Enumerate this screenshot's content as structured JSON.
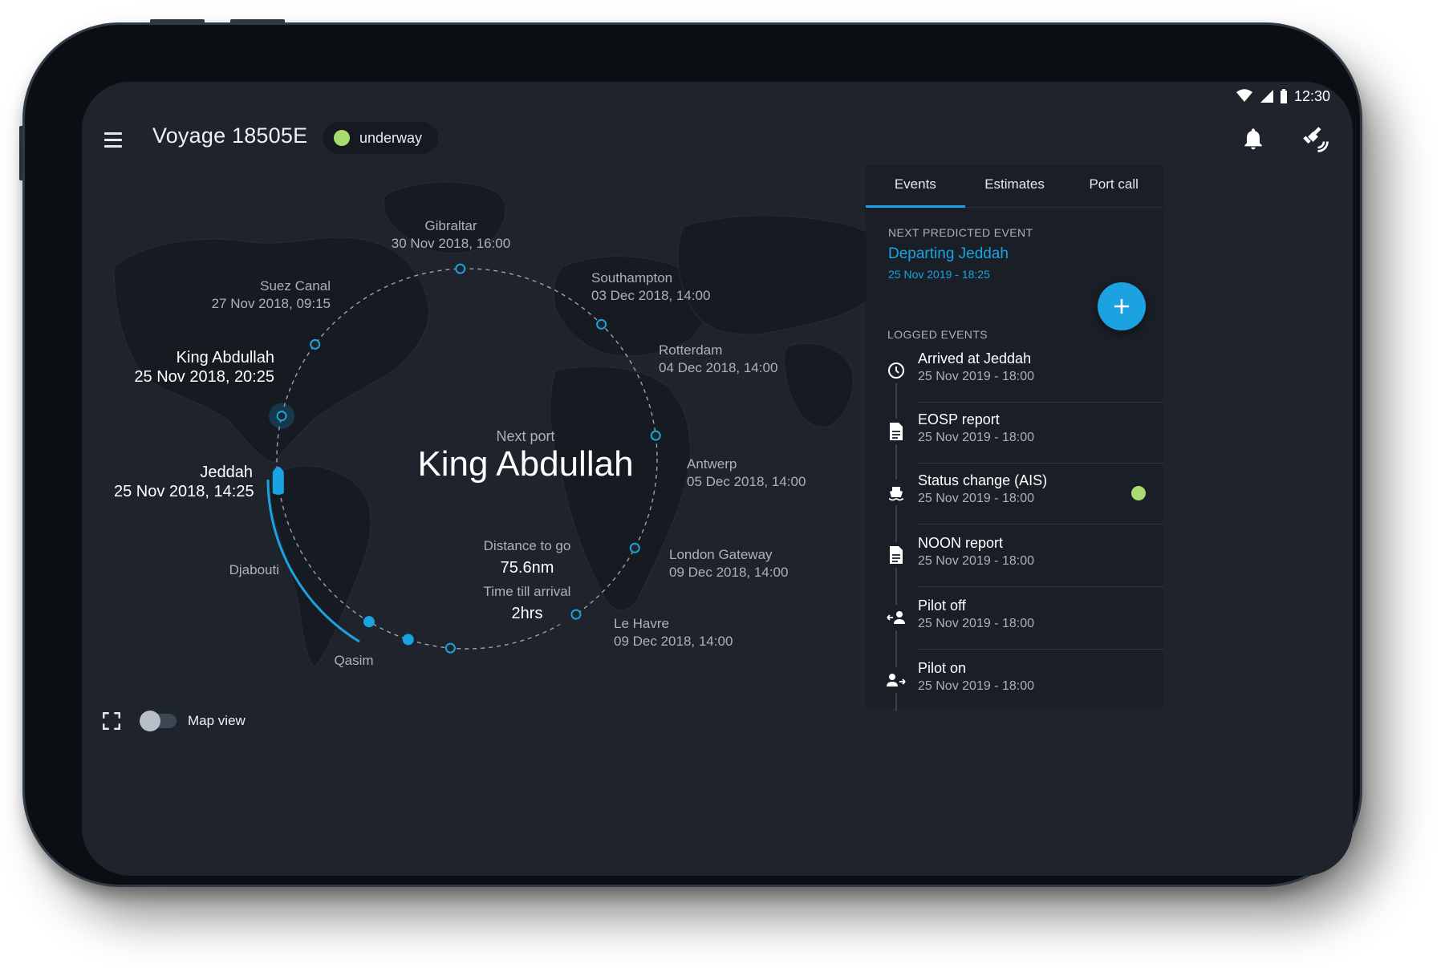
{
  "status_bar": {
    "time": "12:30",
    "icons": [
      "wifi-icon",
      "signal-icon",
      "battery-icon"
    ]
  },
  "header": {
    "title": "Voyage 18505E",
    "status": "underway",
    "status_color": "#a8dc70",
    "icons": [
      "menu-icon",
      "bell-icon",
      "satellite-icon"
    ]
  },
  "map": {
    "next_port_label": "Next port",
    "next_port": "King Abdullah",
    "distance_label": "Distance to go",
    "distance_value": "75.6nm",
    "time_label": "Time till arrival",
    "time_value": "2hrs",
    "route_color": "#1aa3e0",
    "waypoints": [
      {
        "name": "Gibraltar",
        "time": "30 Nov 2018, 16:00"
      },
      {
        "name": "Suez Canal",
        "time": "27 Nov 2018, 09:15"
      },
      {
        "name": "Southampton",
        "time": "03 Dec 2018, 14:00"
      },
      {
        "name": "King Abdullah",
        "time": "25 Nov 2018, 20:25"
      },
      {
        "name": "Rotterdam",
        "time": "04 Dec 2018, 14:00"
      },
      {
        "name": "Jeddah",
        "time": "25 Nov 2018, 14:25"
      },
      {
        "name": "Antwerp",
        "time": "05 Dec 2018, 14:00"
      },
      {
        "name": "London Gateway",
        "time": "09 Dec 2018, 14:00"
      },
      {
        "name": "Djabouti",
        "time": ""
      },
      {
        "name": "Le Havre",
        "time": "09 Dec 2018, 14:00"
      },
      {
        "name": "Qasim",
        "time": ""
      }
    ],
    "map_view_label": "Map view",
    "map_view_on": false
  },
  "panel": {
    "tabs": [
      "Events",
      "Estimates",
      "Port call"
    ],
    "active_tab": "Events",
    "next_predicted_header": "NEXT PREDICTED EVENT",
    "next_predicted_title": "Departing Jeddah",
    "next_predicted_time": "25 Nov 2019 - 18:25",
    "logged_header": "LOGGED EVENTS",
    "events": [
      {
        "title": "Arrived at Jeddah",
        "time": "25 Nov 2019 - 18:00",
        "icon": "clock-icon"
      },
      {
        "title": "EOSP report",
        "time": "25 Nov 2019 - 18:00",
        "icon": "document-icon"
      },
      {
        "title": "Status change (AIS)",
        "time": "25 Nov 2019 - 18:00",
        "icon": "ship-icon",
        "status_color": "#a8dc70"
      },
      {
        "title": "NOON report",
        "time": "25 Nov 2019 - 18:00",
        "icon": "document-icon"
      },
      {
        "title": "Pilot off",
        "time": "25 Nov 2019 - 18:00",
        "icon": "pilot-off-icon"
      },
      {
        "title": "Pilot on",
        "time": "25 Nov 2019 - 18:00",
        "icon": "pilot-on-icon"
      }
    ]
  }
}
